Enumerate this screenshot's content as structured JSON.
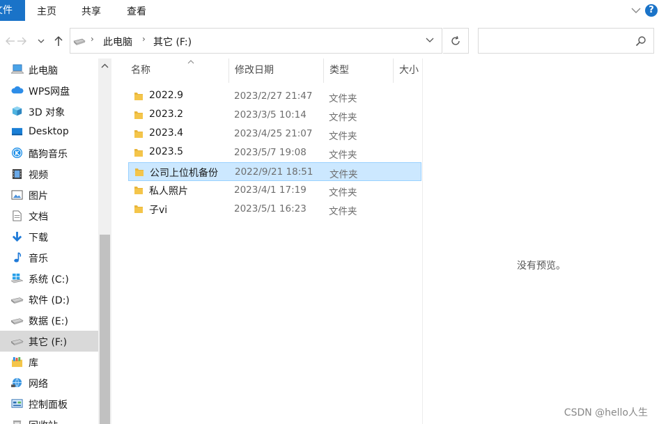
{
  "ribbon": {
    "file_tab": "文件",
    "tabs": [
      "主页",
      "共享",
      "查看"
    ],
    "help": "?"
  },
  "address": {
    "crumbs": [
      "此电脑",
      "其它 (F:)"
    ]
  },
  "search": {
    "placeholder": ""
  },
  "sidebar": {
    "items": [
      {
        "label": "此电脑",
        "icon": "computer-icon"
      },
      {
        "label": "WPS网盘",
        "icon": "cloud-icon"
      },
      {
        "label": "3D 对象",
        "icon": "cube-icon"
      },
      {
        "label": "Desktop",
        "icon": "desktop-icon"
      },
      {
        "label": "酷狗音乐",
        "icon": "kugou-icon"
      },
      {
        "label": "视频",
        "icon": "video-icon"
      },
      {
        "label": "图片",
        "icon": "picture-icon"
      },
      {
        "label": "文档",
        "icon": "document-icon"
      },
      {
        "label": "下载",
        "icon": "download-icon"
      },
      {
        "label": "音乐",
        "icon": "music-icon"
      },
      {
        "label": "系统 (C:)",
        "icon": "windows-drive-icon"
      },
      {
        "label": "软件 (D:)",
        "icon": "drive-icon"
      },
      {
        "label": "数据 (E:)",
        "icon": "drive-icon"
      },
      {
        "label": "其它 (F:)",
        "icon": "drive-icon",
        "selected": true
      },
      {
        "label": "库",
        "icon": "library-icon"
      },
      {
        "label": "网络",
        "icon": "network-icon"
      },
      {
        "label": "控制面板",
        "icon": "control-panel-icon"
      },
      {
        "label": "回收站",
        "icon": "recycle-bin-icon"
      }
    ]
  },
  "columns": {
    "name": "名称",
    "date": "修改日期",
    "type": "类型",
    "size": "大小"
  },
  "files": [
    {
      "name": "2022.9",
      "date": "2023/2/27 21:47",
      "type": "文件夹"
    },
    {
      "name": "2023.2",
      "date": "2023/3/5 10:14",
      "type": "文件夹"
    },
    {
      "name": "2023.4",
      "date": "2023/4/25 21:07",
      "type": "文件夹"
    },
    {
      "name": "2023.5",
      "date": "2023/5/7 19:08",
      "type": "文件夹"
    },
    {
      "name": "公司上位机备份",
      "date": "2022/9/21 18:51",
      "type": "文件夹",
      "selected": true
    },
    {
      "name": "私人照片",
      "date": "2023/4/1 17:19",
      "type": "文件夹"
    },
    {
      "name": "子vi",
      "date": "2023/5/1 16:23",
      "type": "文件夹"
    }
  ],
  "preview": {
    "message": "没有预览。"
  },
  "watermark": "CSDN @hello人生",
  "colors": {
    "accent": "#1a73c8",
    "selection": "#cce8ff",
    "folder": "#f4c54a"
  }
}
